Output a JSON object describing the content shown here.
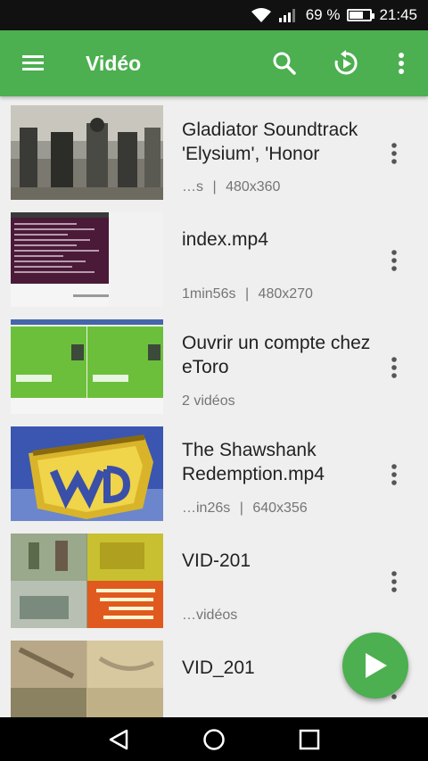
{
  "status_bar": {
    "battery_percent": "69 %",
    "battery_level": 0.69,
    "time": "21:45",
    "icons": [
      "wifi-icon",
      "signal-icon",
      "battery-icon"
    ]
  },
  "app_bar": {
    "title": "Vidéo",
    "background": "#4caf50",
    "icons": [
      "hamburger-menu-icon",
      "search-icon",
      "resume-playback-icon",
      "overflow-menu-icon"
    ]
  },
  "videos": [
    {
      "title": "Gladiator Soundtrack 'Elysium', 'Honor Him',…",
      "duration": "…s",
      "resolution": "480x360",
      "separator": "|"
    },
    {
      "title": "index.mp4",
      "duration": "1min56s",
      "resolution": "480x270",
      "separator": "|"
    },
    {
      "title": "Ouvrir un compte chez eToro",
      "duration": "2 vidéos",
      "resolution": "",
      "separator": ""
    },
    {
      "title": "The Shawshank Redemption.mp4",
      "duration": "…in26s",
      "resolution": "640x356",
      "separator": "|"
    },
    {
      "title": "VID-201",
      "duration": "…vidéos",
      "resolution": "",
      "separator": ""
    },
    {
      "title": "VID_201",
      "duration": "",
      "resolution": "",
      "separator": ""
    }
  ],
  "fab": {
    "icon": "play-icon"
  },
  "nav_bar": {
    "icons": [
      "back-icon",
      "home-icon",
      "recents-icon"
    ]
  }
}
